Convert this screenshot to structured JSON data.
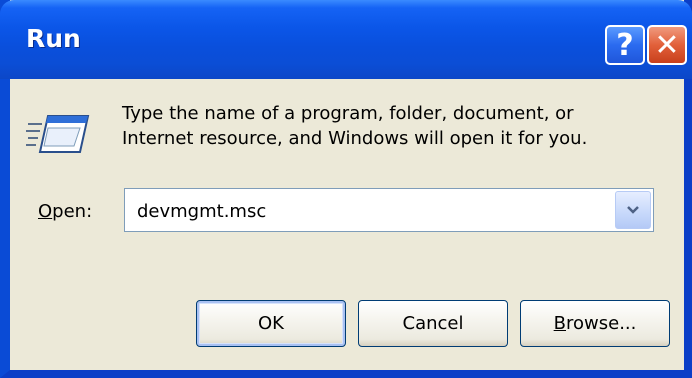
{
  "window": {
    "title": "Run",
    "help_label": "?",
    "close_label": "✕"
  },
  "icons": {
    "run": "run-program-icon",
    "help": "help-icon",
    "close": "close-icon",
    "dropdown": "chevron-down-icon"
  },
  "description": {
    "line1": "Type the name of a program, folder, document, or",
    "line2": "Internet resource, and Windows will open it for you."
  },
  "open": {
    "label_underlined": "O",
    "label_rest": "pen:",
    "value": "devmgmt.msc"
  },
  "buttons": {
    "ok": "OK",
    "cancel": "Cancel",
    "browse_underlined": "B",
    "browse_rest": "rowse..."
  },
  "colors": {
    "titlebar": "#0B56E8",
    "dialog_bg": "#ECE9D8",
    "close": "#E2603A",
    "border": "#0A4BD6"
  }
}
